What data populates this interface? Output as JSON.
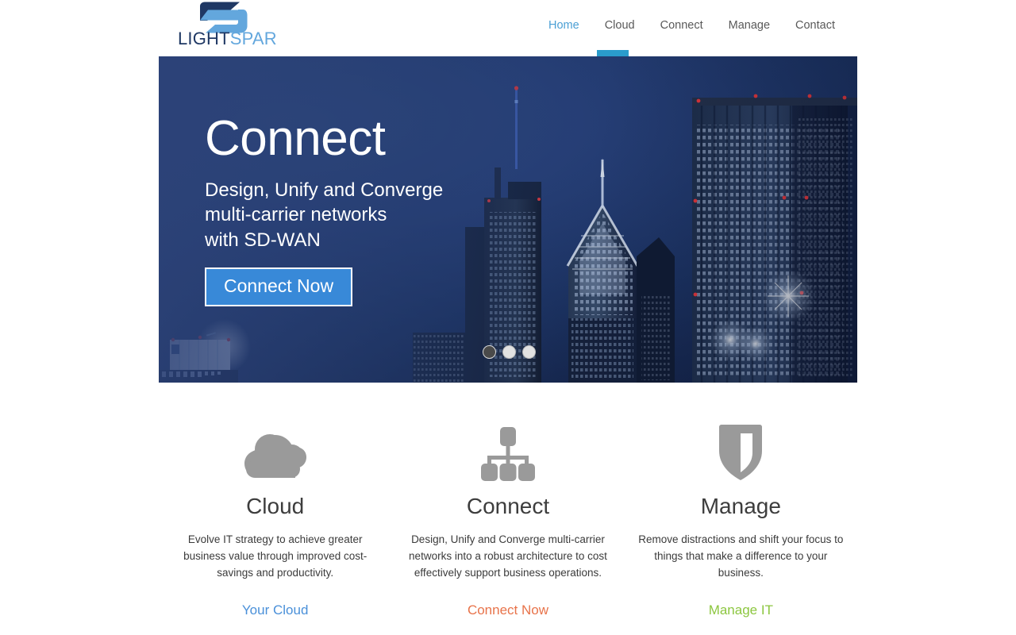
{
  "brand": {
    "name_part1": "LIGHT",
    "name_part2": "SPAR",
    "color_dark": "#1f3864",
    "color_light": "#63a7dd",
    "logo_icon": "lightspar-logo-icon"
  },
  "nav": {
    "items": [
      {
        "label": "Home",
        "active": true
      },
      {
        "label": "Cloud",
        "active": false
      },
      {
        "label": "Connect",
        "active": false
      },
      {
        "label": "Manage",
        "active": false
      },
      {
        "label": "Contact",
        "active": false
      }
    ],
    "active_color": "#4a9fd4",
    "inactive_color": "#595959",
    "indicator_color": "#2a9ccc"
  },
  "hero": {
    "title": "Connect",
    "subtitle_line1": "Design, Unify and Converge",
    "subtitle_line2": "multi-carrier networks",
    "subtitle_line3": "with SD-WAN",
    "cta_label": "Connect Now",
    "cta_bg": "#3889d8",
    "background_description": "night city skyline",
    "carousel": {
      "slides": [
        {
          "active": true
        },
        {
          "active": false
        },
        {
          "active": false
        }
      ],
      "active_index": 0,
      "count": 3
    }
  },
  "features": [
    {
      "icon": "cloud-icon",
      "title": "Cloud",
      "description": "Evolve IT strategy to achieve greater business value through improved cost-savings and productivity.",
      "link_label": "Your Cloud",
      "link_color": "#4a90d9"
    },
    {
      "icon": "sitemap-icon",
      "title": "Connect",
      "description": "Design, Unify and Converge multi-carrier networks into a robust architecture to cost effectively support business operations.",
      "link_label": "Connect Now",
      "link_color": "#e8734a"
    },
    {
      "icon": "shield-icon",
      "title": "Manage",
      "description": "Remove distractions and shift your focus to things that make a difference to your business.",
      "link_label": "Manage IT",
      "link_color": "#8cc63f"
    }
  ]
}
